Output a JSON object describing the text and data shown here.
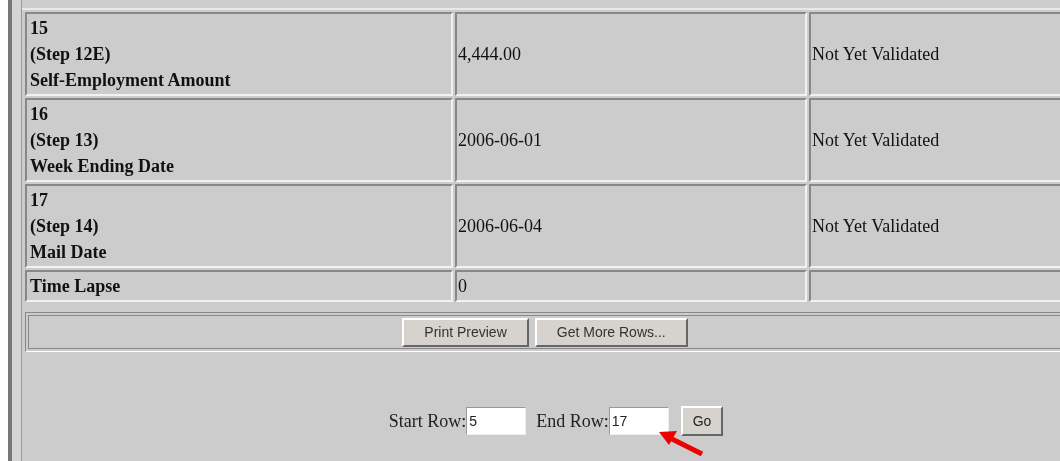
{
  "table": {
    "rows": [
      {
        "label": [
          "15",
          "(Step 12E)",
          "Self-Employment Amount"
        ],
        "value": "4,444.00",
        "status": "Not Yet Validated"
      },
      {
        "label": [
          "16",
          "(Step 13)",
          "Week Ending Date"
        ],
        "value": "2006-06-01",
        "status": "Not Yet Validated"
      },
      {
        "label": [
          "17",
          "(Step 14)",
          "Mail Date"
        ],
        "value": "2006-06-04",
        "status": "Not Yet Validated"
      },
      {
        "label": [
          "Time Lapse"
        ],
        "value": "0"
      }
    ]
  },
  "buttons": [
    "Print Preview",
    "Get More Rows..."
  ],
  "range": {
    "start_label": "Start Row:",
    "start_value": "5",
    "end_label": "End Row:",
    "end_value": "17",
    "go": "Go"
  }
}
